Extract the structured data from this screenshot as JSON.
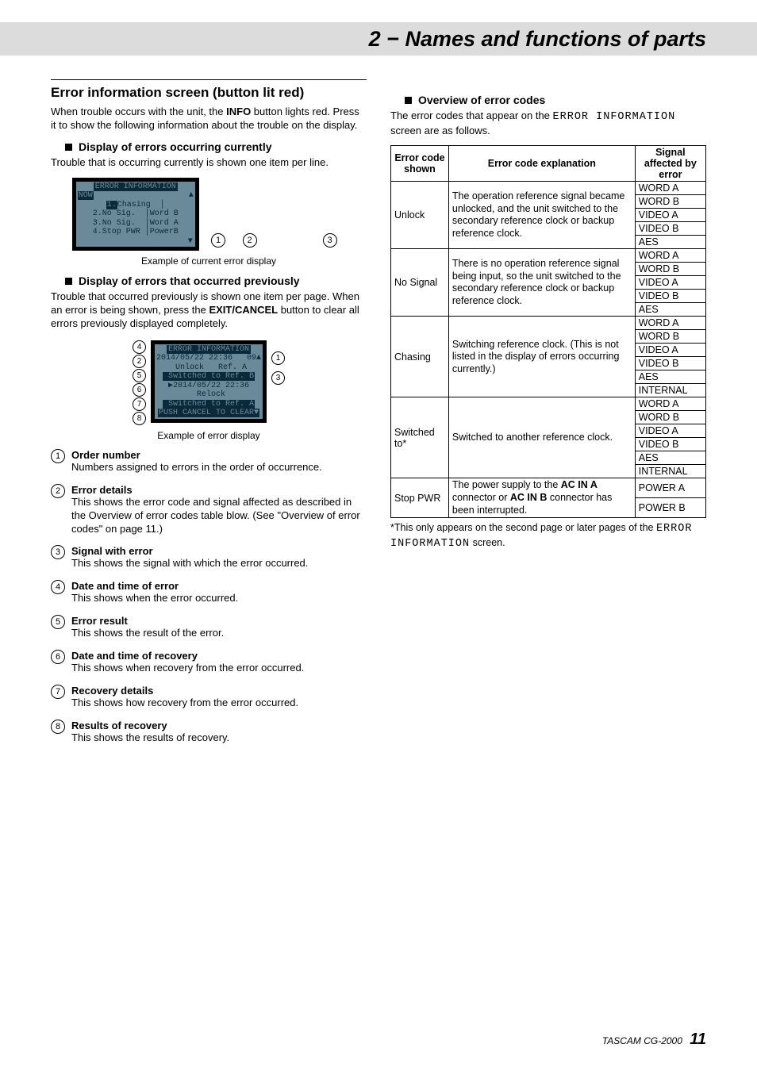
{
  "header": {
    "title": "2 − Names and functions of parts"
  },
  "left": {
    "section_title": "Error information screen (button lit red)",
    "intro_1": "When trouble occurs with the unit, the ",
    "intro_bold": "INFO",
    "intro_2": " button lights red. Press it to show the following information about the trouble on the display.",
    "sub1": "Display of errors occurring currently",
    "sub1_body": "Trouble that is occurring currently is shown one item per line.",
    "fig1_cap": "Example of current error display",
    "sub2": "Display of errors that occurred previously",
    "sub2_body_1": "Trouble that occurred previously is shown one item per page. When an error is being shown, press the ",
    "sub2_body_bold": "EXIT/CANCEL",
    "sub2_body_2": " button to clear all errors previously displayed completely.",
    "fig2_cap": "Example of error display",
    "items": [
      {
        "n": "1",
        "title": "Order number",
        "desc": "Numbers assigned to errors in the order of occurrence."
      },
      {
        "n": "2",
        "title": "Error details",
        "desc": "This shows the error code and signal affected as described in the Overview of error codes table blow. (See \"Overview of error codes\" on page 11.)"
      },
      {
        "n": "3",
        "title": "Signal with error",
        "desc": "This shows the signal with which the error occurred."
      },
      {
        "n": "4",
        "title": "Date and time of error",
        "desc": "This shows when the error occurred."
      },
      {
        "n": "5",
        "title": "Error result",
        "desc": "This shows the result of the error."
      },
      {
        "n": "6",
        "title": "Date and time of recovery",
        "desc": "This shows when recovery from the error occurred."
      },
      {
        "n": "7",
        "title": "Recovery details",
        "desc": "This shows how recovery from the error occurred."
      },
      {
        "n": "8",
        "title": "Results of recovery",
        "desc": "This shows the results of recovery."
      }
    ],
    "lcd1": {
      "title": "ERROR INFORMATION",
      "now": "NOW",
      "r1a": "1.",
      "r1b": "Chasing",
      "r1c": "",
      "r2a": "2.",
      "r2b": "No Sig.",
      "r2c": "Word B",
      "r3a": "3.",
      "r3b": "No Sig.",
      "r3c": "Word A",
      "r4a": "4.",
      "r4b": "Stop PWR",
      "r4c": "PowerB"
    },
    "lcd2": {
      "title": "ERROR INFORMATION",
      "l1": "2014/05/22 22:36   09▲",
      "l2": " Unlock   Ref. A",
      "l3": " Switched to Ref. B",
      "l4": "▶2014/05/22 22:36",
      "l5": " Relock",
      "l6": " Switched to Ref. A",
      "l7": "PUSH CANCEL TO CLEAR▼"
    }
  },
  "right": {
    "sub": "Overview of error codes",
    "intro_a": "The error codes that appear on the ",
    "intro_mono": "ERROR INFORMATION",
    "intro_b": " screen are as follows.",
    "th1": "Error code shown",
    "th2": "Error code explanation",
    "th3": "Signal affected by error",
    "rows": [
      {
        "code": "Unlock",
        "expl": "The operation reference signal became unlocked, and the unit switched to the secondary reference clock or backup reference clock.",
        "sigs": [
          "WORD A",
          "WORD B",
          "VIDEO A",
          "VIDEO B",
          "AES"
        ]
      },
      {
        "code": "No Signal",
        "expl": "There is no operation reference signal being input, so the unit switched to the secondary reference clock or backup reference clock.",
        "sigs": [
          "WORD A",
          "WORD B",
          "VIDEO A",
          "VIDEO B",
          "AES"
        ]
      },
      {
        "code": "Chasing",
        "expl": "Switching reference clock. (This is not listed in the display of errors occurring currently.)",
        "sigs": [
          "WORD A",
          "WORD B",
          "VIDEO A",
          "VIDEO B",
          "AES",
          "INTERNAL"
        ]
      },
      {
        "code": "Switched to*",
        "expl": "Switched to another reference clock.",
        "sigs": [
          "WORD A",
          "WORD B",
          "VIDEO A",
          "VIDEO B",
          "AES",
          "INTERNAL"
        ]
      },
      {
        "code": "Stop PWR",
        "expl_parts": [
          "The power supply to the ",
          "AC IN A",
          " connector or ",
          "AC IN B",
          " connector has been interrupted."
        ],
        "sigs": [
          "POWER A",
          "POWER B"
        ]
      }
    ],
    "footnote_a": "*This only appears on the second page or later pages of the ",
    "footnote_mono": "ERROR INFORMATION",
    "footnote_b": " screen."
  },
  "footer": {
    "product": "TASCAM CG-2000",
    "page": "11"
  }
}
